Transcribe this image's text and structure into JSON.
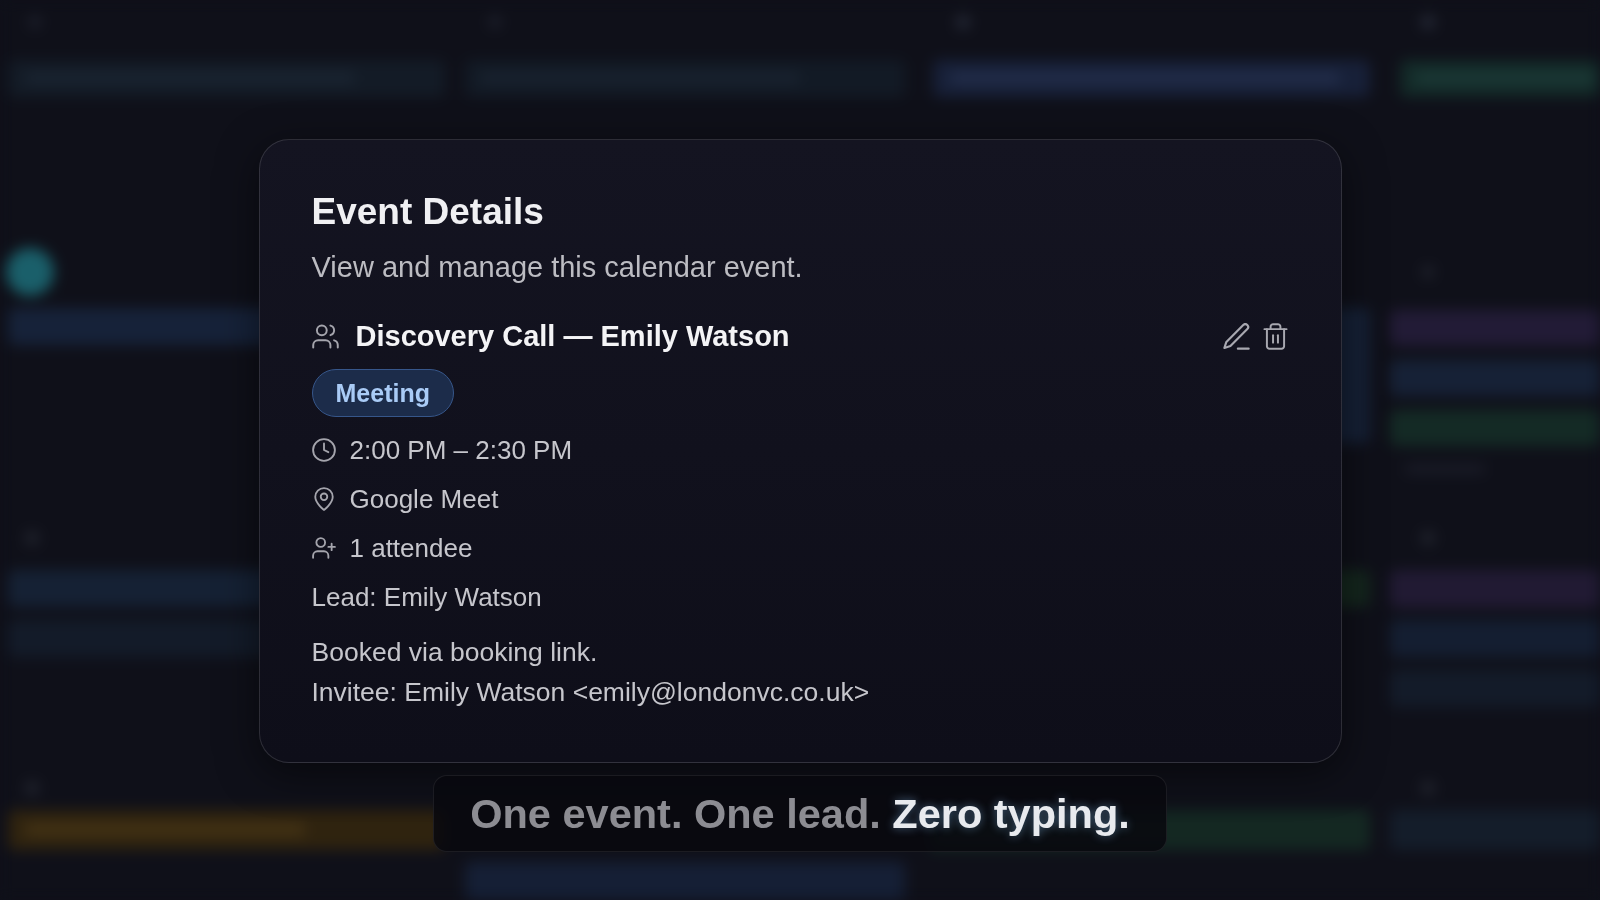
{
  "dialog": {
    "title": "Event Details",
    "description": "View and manage this calendar event.",
    "event": {
      "title": "Discovery Call — Emily Watson",
      "category": "Meeting",
      "details": [
        {
          "kind": "time",
          "text": "2:00 PM – 2:30 PM"
        },
        {
          "kind": "location",
          "text": "Google Meet"
        },
        {
          "kind": "attendees",
          "text": "1 attendee"
        },
        {
          "kind": "lead",
          "text": "Lead: Emily Watson"
        }
      ],
      "notes": [
        "Booked via booking link.",
        "Invitee: Emily Watson <emily@londonvc.co.uk>"
      ]
    }
  },
  "caption": {
    "parts": [
      {
        "text": "One event. One lead.",
        "highlight": false
      },
      {
        "text": "Zero typing.",
        "highlight": true
      }
    ]
  }
}
